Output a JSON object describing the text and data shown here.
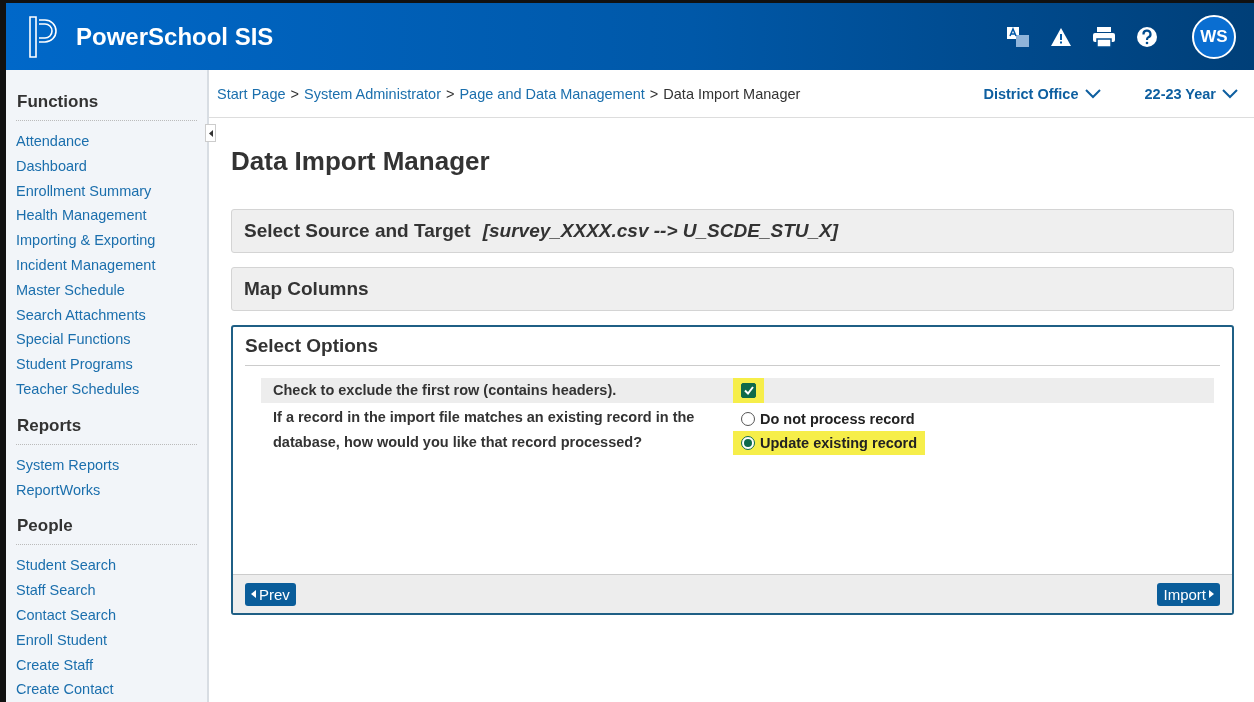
{
  "header": {
    "title": "PowerSchool SIS",
    "avatar": "WS"
  },
  "sidebar": {
    "sections": [
      {
        "title": "Functions",
        "items": [
          "Attendance",
          "Dashboard",
          "Enrollment Summary",
          "Health Management",
          "Importing & Exporting",
          "Incident Management",
          "Master Schedule",
          "Search Attachments",
          "Special Functions",
          "Student Programs",
          "Teacher Schedules"
        ]
      },
      {
        "title": "Reports",
        "items": [
          "System Reports",
          "ReportWorks"
        ]
      },
      {
        "title": "People",
        "items": [
          "Student Search",
          "Staff Search",
          "Contact Search",
          "Enroll Student",
          "Create Staff",
          "Create Contact"
        ]
      }
    ]
  },
  "breadcrumb": {
    "links": [
      "Start Page",
      "System Administrator",
      "Page and Data Management"
    ],
    "current": "Data Import Manager",
    "separator": ">"
  },
  "selectors": [
    "District Office",
    "22-23 Year"
  ],
  "page_title": "Data Import Manager",
  "panels": [
    {
      "title": "Select Source and Target",
      "detail": "[survey_XXXX.csv --> U_SCDE_STU_X]",
      "expanded": false
    },
    {
      "title": "Map Columns",
      "expanded": false
    },
    {
      "title": "Select Options",
      "expanded": true
    }
  ],
  "options": {
    "exclude_first_row": {
      "label": "Check to exclude the first row (contains headers).",
      "checked": true,
      "highlighted": true
    },
    "match_question": "If a record in the import file matches an existing record in the database, how would you like that record processed?",
    "choices": [
      {
        "label": "Do not process record",
        "selected": false,
        "highlighted": false
      },
      {
        "label": "Update existing record",
        "selected": true,
        "highlighted": true
      }
    ]
  },
  "buttons": {
    "prev": "Prev",
    "next": "Import"
  }
}
